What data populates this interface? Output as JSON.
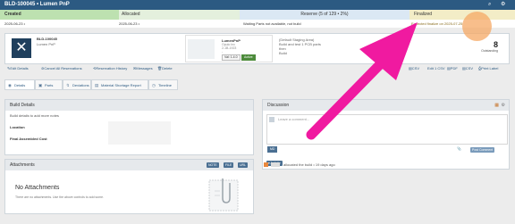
{
  "window": {
    "title": "BLD-100045 • Lumen PnP",
    "icons": [
      "search-icon",
      "gear-icon"
    ]
  },
  "stages": {
    "created": "Created",
    "allocated": "Allocated",
    "reserve": "Reserve (5 of 129 • 2%)",
    "finalized": "Finalized",
    "colors": {
      "created": "#bde1b0",
      "allocated": "#e4f0dd",
      "reserve": "#dbe8f4",
      "finalized": "#f3edc7"
    }
  },
  "dates": {
    "created": "2025-06-23 •",
    "allocated": "2025-06-23 •",
    "reserve": "Waiting Parts not available, not build",
    "finalized": "Expected finalize on 2025-07-25"
  },
  "build": {
    "id": "BLD-100045",
    "name": "Lumen PnP",
    "product_name": "LumenPnP",
    "product_lines": [
      "Opulo Inc",
      "2-1B-1923",
      "-"
    ],
    "chip_value": "Val: 1.4.0",
    "chip_status": "Active",
    "description_lines": [
      "(Default Staging Area)",
      "Build and test 1 PCB parts",
      "then",
      "Build"
    ],
    "counter_value": "8",
    "counter_label": "Outstanding"
  },
  "actions": {
    "left": [
      "Edit Details",
      "Cancel All Reservations",
      "Reservation History",
      "Messages",
      "Delete"
    ],
    "right": [
      "Email",
      "CSV",
      "Edit 1 CSV",
      "PDF",
      "CSV",
      "Print Label"
    ]
  },
  "tabs": [
    "Details",
    "Parts",
    "Deviations",
    "Material Shortage Report",
    "Timeline"
  ],
  "build_details": {
    "heading": "Build Details",
    "note": "Build details to add more notes",
    "location_label": "Location",
    "final_label": "Final Assembled Cost"
  },
  "attachments": {
    "heading": "Attachments",
    "buttons": [
      "NOTE",
      "FILE",
      "URL"
    ],
    "empty_title": "No Attachments",
    "empty_text": "There are no attachments. Use the above controls to add some."
  },
  "discussion": {
    "heading": "Discussion",
    "placeholder": "Leave a comment...",
    "md_badge": "MD",
    "post_label": "Post Comment",
    "activity_label": "Activity",
    "activity_text": "allocated the build • 19 days ago"
  }
}
